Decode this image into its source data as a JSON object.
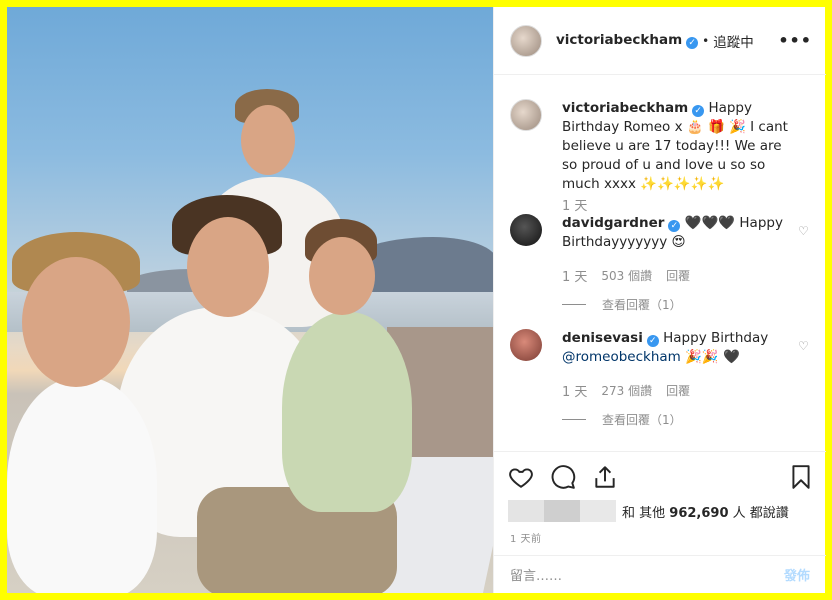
{
  "header": {
    "username": "victoriabeckham",
    "separator": "•",
    "follow_status": "追蹤中",
    "more": "•••"
  },
  "caption": {
    "username": "victoriabeckham",
    "text": "Happy Birthday Romeo x 🎂 🎁 🎉 I cant believe u are 17 today!!! We are so proud of u and love u so so much xxxx ✨✨✨✨✨",
    "time": "1 天"
  },
  "comments": [
    {
      "username": "davidgardner",
      "text": "🖤🖤🖤 Happy Birthdayyyyyyy 😍",
      "time": "1 天",
      "likes": "503 個讚",
      "reply": "回覆",
      "view_replies": "查看回覆（1）"
    },
    {
      "username": "denisevasi",
      "text": "Happy Birthday",
      "mention": "@romeobeckham",
      "emoji": "🎉🎉 🖤",
      "time": "1 天",
      "likes": "273 個讚",
      "reply": "回覆",
      "view_replies": "查看回覆（1）"
    }
  ],
  "likes": {
    "prefix": "和 其他",
    "count": "962,690",
    "suffix": "人 都說讚"
  },
  "post_time": "1 天前",
  "comment_box": {
    "placeholder": "留言……",
    "post_label": "發佈"
  },
  "icons": {
    "like": "heart-icon",
    "comment": "comment-icon",
    "share": "share-icon",
    "save": "bookmark-icon"
  },
  "colors": {
    "frame": "#ffff00",
    "verified": "#3897f0",
    "post_button": "#b3dbff",
    "meta_text": "#8e8e8e"
  }
}
